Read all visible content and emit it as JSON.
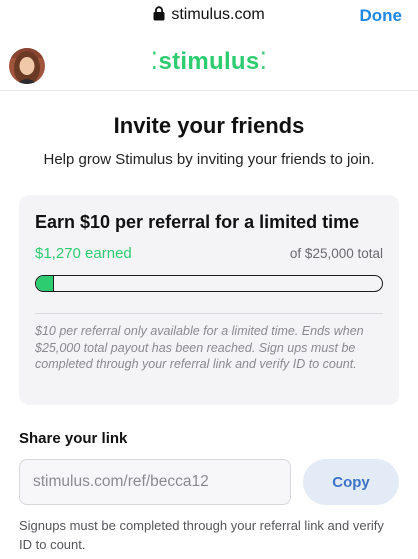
{
  "browser": {
    "url": "stimulus.com",
    "done_label": "Done"
  },
  "header": {
    "logo_text": "stimulus",
    "logo_mark_left": "⁚",
    "logo_mark_right": "⁚",
    "brand_color": "#2ecc71"
  },
  "page": {
    "title": "Invite your friends",
    "subtitle": "Help grow Stimulus by inviting your friends to join."
  },
  "referral_card": {
    "title": "Earn $10 per referral for a limited time",
    "earned_text": "$1,270 earned",
    "total_text": "of $25,000 total",
    "progress_fraction": 0.0508,
    "note": "$10 per referral only available for a limited time. Ends when $25,000 total payout has been reached. Sign ups must be completed through your referral link and verify ID to count."
  },
  "share": {
    "heading": "Share your link",
    "link_value": "stimulus.com/ref/becca12",
    "copy_label": "Copy",
    "footer_note": "Signups must be completed through your referral link and verify ID to count."
  },
  "icons": {
    "lock": "lock-icon",
    "avatar": "avatar"
  }
}
